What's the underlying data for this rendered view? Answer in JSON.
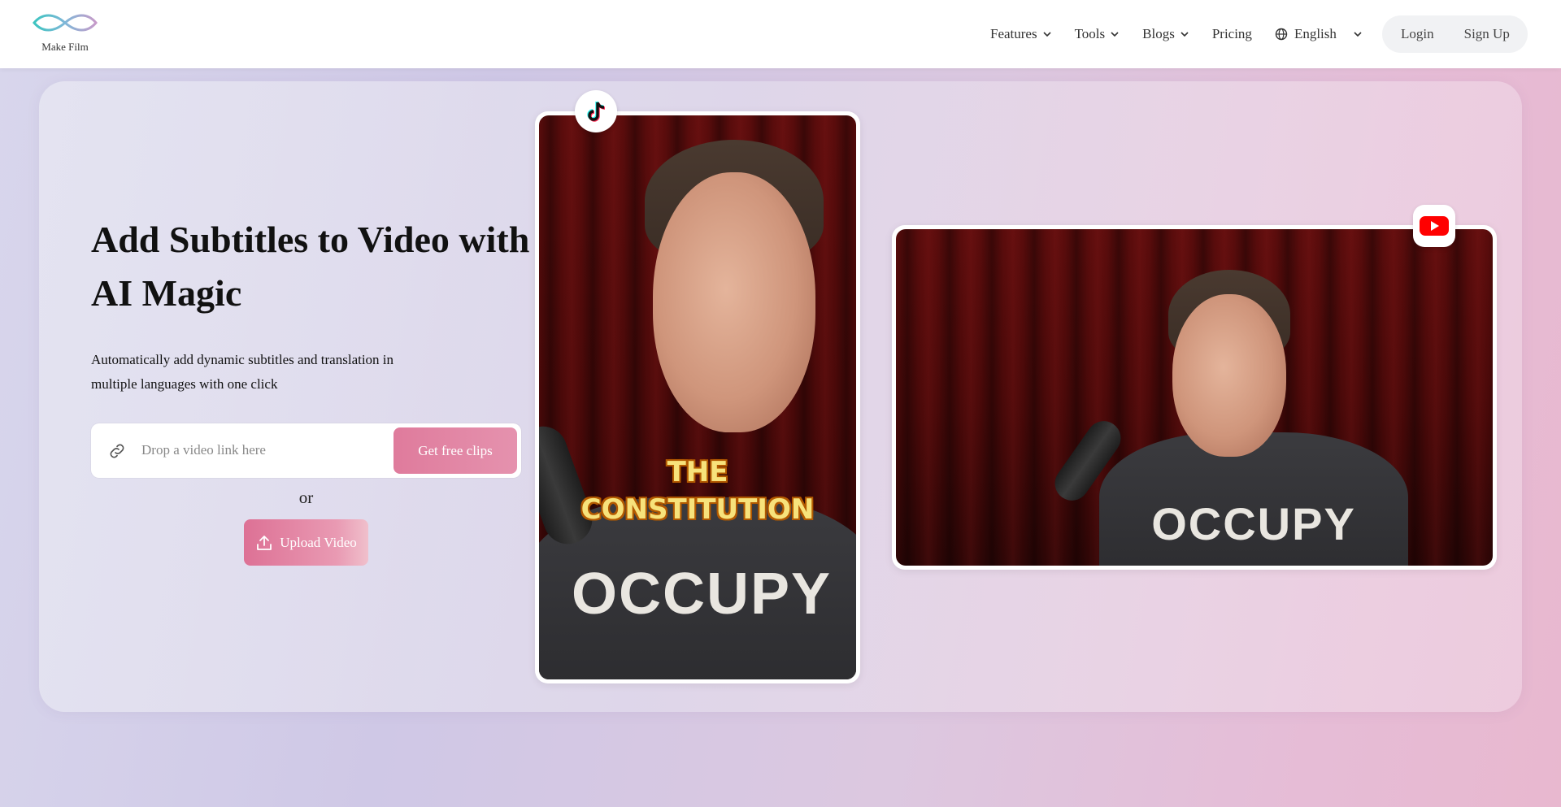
{
  "brand": {
    "name": "Make Film"
  },
  "nav": {
    "items": [
      {
        "label": "Features",
        "dropdown": true
      },
      {
        "label": "Tools",
        "dropdown": true
      },
      {
        "label": "Blogs",
        "dropdown": true
      },
      {
        "label": "Pricing",
        "dropdown": false
      }
    ],
    "language": "English",
    "login": "Login",
    "signup": "Sign Up"
  },
  "hero": {
    "title": "Add Subtitles to Video with AI Magic",
    "subtitle": "Automatically add dynamic subtitles and translation in multiple languages with one click",
    "link_placeholder": "Drop a video link here",
    "get_clips": "Get free clips",
    "or": "or",
    "upload": "Upload Video"
  },
  "media": {
    "vertical_caption_line1": "THE",
    "vertical_caption_line2": "CONSTITUTION",
    "shirt_text": "OCCUPY",
    "vertical_badge_icon": "tiktok-icon",
    "horizontal_badge_icon": "youtube-icon"
  },
  "colors": {
    "accent": "#df7b9c",
    "caption": "#f7e27b",
    "youtube": "#ff0000"
  }
}
